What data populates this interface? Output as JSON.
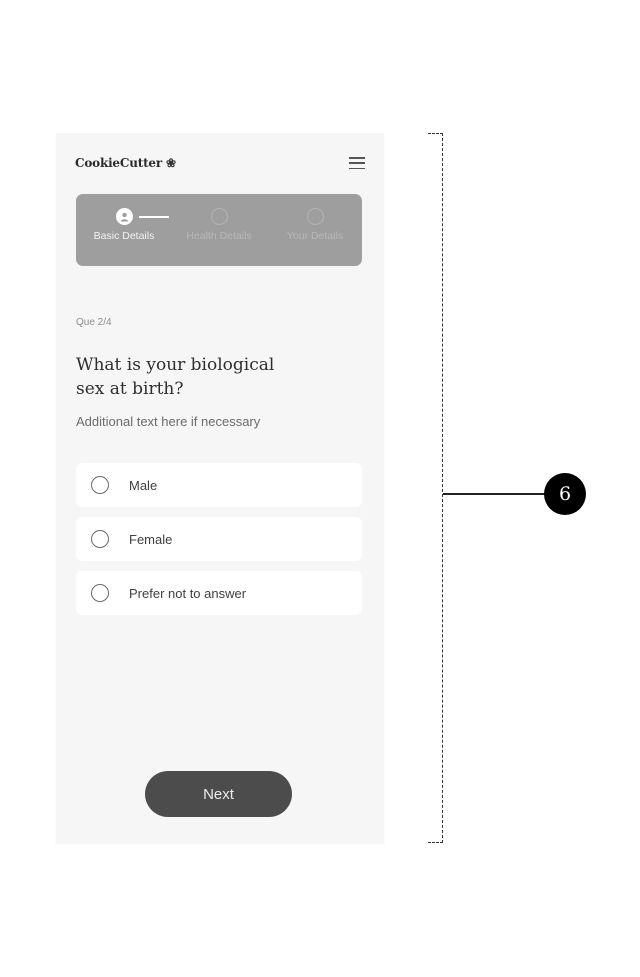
{
  "app": {
    "logo_text": "CookieCutter",
    "logo_icon": "cookie-cutter-icon",
    "menu_icon": "hamburger-menu-icon"
  },
  "stepper": {
    "steps": [
      {
        "label": "Basic Details",
        "state": "active",
        "icon": "user-icon"
      },
      {
        "label": "Health Details",
        "state": "inactive"
      },
      {
        "label": "Your Details",
        "state": "inactive"
      }
    ]
  },
  "question": {
    "counter": "Que 2/4",
    "title": "What is your biological sex at birth?",
    "subtext": "Additional text here if necessary",
    "options": [
      {
        "label": "Male",
        "selected": false
      },
      {
        "label": "Female",
        "selected": false
      },
      {
        "label": "Prefer not to answer",
        "selected": false
      }
    ]
  },
  "actions": {
    "next_label": "Next"
  },
  "annotation": {
    "number": "6"
  }
}
